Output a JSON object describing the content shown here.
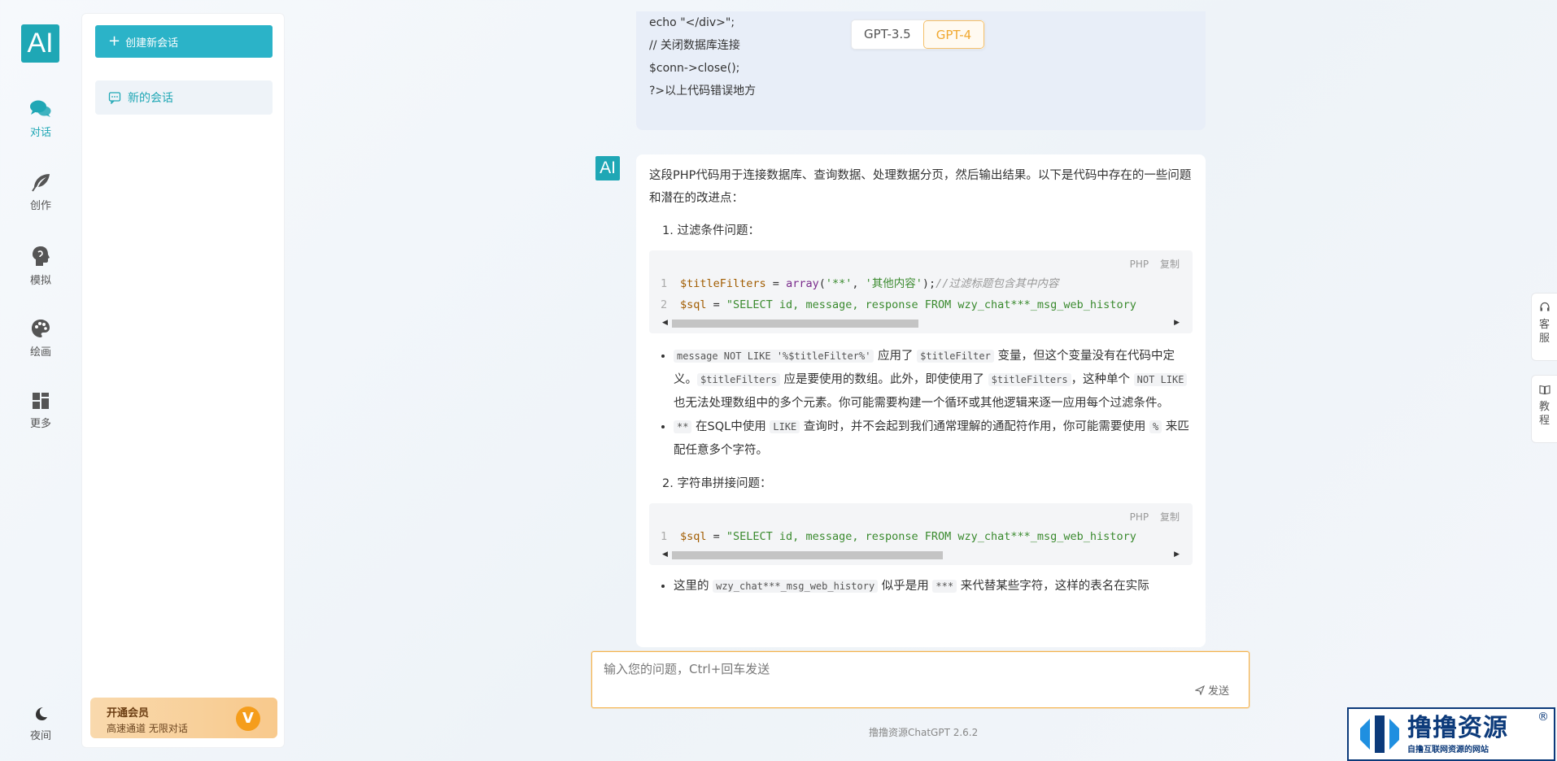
{
  "rail": {
    "logo": "AI",
    "items": [
      {
        "label": "对话",
        "icon": "chat-bubbles-icon",
        "active": true
      },
      {
        "label": "创作",
        "icon": "feather-icon",
        "active": false
      },
      {
        "label": "模拟",
        "icon": "head-profile-icon",
        "active": false
      },
      {
        "label": "绘画",
        "icon": "palette-icon",
        "active": false
      },
      {
        "label": "更多",
        "icon": "grid-icon",
        "active": false
      }
    ],
    "night_label": "夜间"
  },
  "panel": {
    "new_chat_label": "创建新会话",
    "session_label": "新的会话",
    "vip_title": "开通会员",
    "vip_subtitle": "高速通道 无限对话",
    "vip_badge": "V"
  },
  "model_switch": {
    "options": [
      "GPT-3.5",
      "GPT-4"
    ],
    "selected": "GPT-4"
  },
  "user_message": {
    "lines": [
      "echo \"</div>\";",
      "",
      "// 关闭数据库连接",
      "$conn->close();",
      "?>以上代码错误地方"
    ]
  },
  "ai_message": {
    "avatar": "AI",
    "intro": "这段PHP代码用于连接数据库、查询数据、处理数据分页，然后输出结果。以下是代码中存在的一些问题和潜在的改进点：",
    "section1_title": "1. 过滤条件问题：",
    "code1": {
      "lang": "PHP",
      "copy": "复制",
      "line1_no": "1",
      "line1_var": "$titleFilters",
      "line1_op": " = ",
      "line1_fn": "array",
      "line1_args_a": "(",
      "line1_str1": "'**'",
      "line1_sep": ", ",
      "line1_str2": "'其他内容'",
      "line1_end": ");",
      "line1_comment": "//过滤标题包含其中内容",
      "line2_no": "2",
      "line2_var": "$sql",
      "line2_op": " = ",
      "line2_str": "\"SELECT id, message, response FROM wzy_chat***_msg_web_history"
    },
    "bullet1": {
      "code_a": "message NOT LIKE '%$titleFilter%'",
      "text_a": " 应用了 ",
      "code_b": "$titleFilter",
      "text_b": " 变量，但这个变量没有在代码中定义。",
      "code_c": "$titleFilters",
      "text_c": " 应是要使用的数组。此外，即使使用了 ",
      "code_d": "$titleFilters",
      "text_d": "，这种单个 ",
      "code_e": "NOT LIKE",
      "text_e": " 也无法处理数组中的多个元素。你可能需要构建一个循环或其他逻辑来逐一应用每个过滤条件。"
    },
    "bullet2": {
      "code_a": "**",
      "text_a": " 在SQL中使用 ",
      "code_b": "LIKE",
      "text_b": " 查询时，并不会起到我们通常理解的通配符作用，你可能需要使用 ",
      "code_c": "%",
      "text_c": " 来匹配任意多个字符。"
    },
    "section2_title": "2. 字符串拼接问题：",
    "code2": {
      "lang": "PHP",
      "copy": "复制",
      "line1_no": "1",
      "line1_var": "$sql",
      "line1_op": " = ",
      "line1_str": "\"SELECT id, message, response FROM wzy_chat***_msg_web_history"
    },
    "bullet3": {
      "text_a": "这里的 ",
      "code_a": "wzy_chat***_msg_web_history",
      "text_b": " 似乎是用 ",
      "code_b": "***",
      "text_c": " 来代替某些字符，这样的表名在实际"
    }
  },
  "input": {
    "placeholder": "输入您的问题，Ctrl+回车发送",
    "send_label": "发送"
  },
  "footer": {
    "version": "撸撸资源ChatGPT 2.6.2"
  },
  "float_tabs": {
    "service": "客服",
    "tutorial": "教程"
  },
  "watermark": {
    "title": "撸撸资源",
    "subtitle": "自撸互联网资源的网站",
    "reg": "®"
  },
  "colors": {
    "accent": "#1fa7b5",
    "primary_button": "#2bb3c8",
    "model_active": "#f0a830",
    "input_border": "#f5b34d"
  }
}
